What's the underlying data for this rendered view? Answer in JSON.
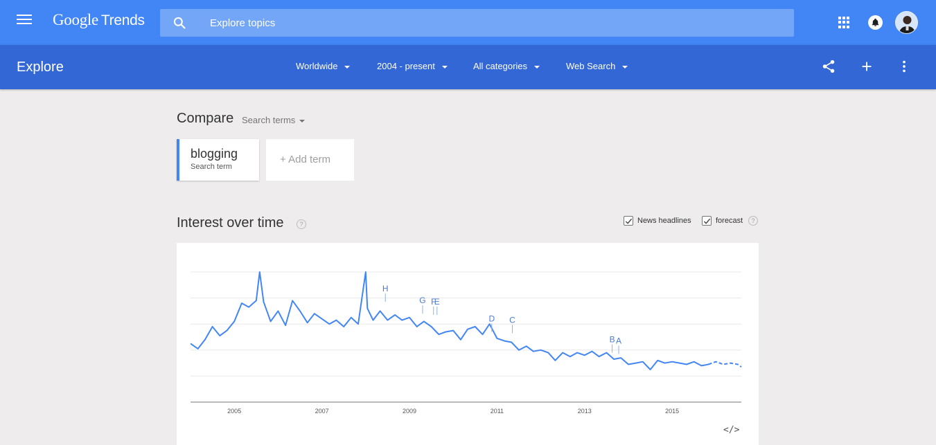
{
  "app": {
    "logo_google": "Google",
    "logo_trends": "Trends"
  },
  "search": {
    "placeholder": "Explore topics"
  },
  "header": {
    "title": "Explore"
  },
  "filters": {
    "region": "Worldwide",
    "time": "2004 - present",
    "category": "All categories",
    "property": "Web Search"
  },
  "compare": {
    "label": "Compare",
    "mode": "Search terms",
    "term": {
      "name": "blogging",
      "type": "Search term"
    },
    "add_label": "+ Add term"
  },
  "interest": {
    "title": "Interest over time",
    "help": "?",
    "news_headlines": "News headlines",
    "forecast": "forecast",
    "embed": "</>"
  },
  "chart_data": {
    "type": "line",
    "title": "",
    "xlabel": "",
    "ylabel": "",
    "xlim": [
      2004.0,
      2016.58
    ],
    "ylim": [
      0,
      100
    ],
    "x_ticks": [
      2005,
      2007,
      2009,
      2011,
      2013,
      2015
    ],
    "tick_labels": [
      "2005",
      "2007",
      "2009",
      "2011",
      "2013",
      "2015"
    ],
    "grid": true,
    "line_color": "#4285f4",
    "series": [
      {
        "x": [
          2004.0,
          2004.17,
          2004.33,
          2004.5,
          2004.67,
          2004.83,
          2005.0,
          2005.17,
          2005.33,
          2005.5,
          2005.58,
          2005.67,
          2005.83,
          2006.0,
          2006.17,
          2006.33,
          2006.5,
          2006.67,
          2006.83,
          2007.0,
          2007.17,
          2007.33,
          2007.5,
          2007.67,
          2007.83,
          2008.0,
          2008.04,
          2008.17,
          2008.33,
          2008.5,
          2008.67,
          2008.83,
          2009.0,
          2009.17,
          2009.33,
          2009.5,
          2009.67,
          2009.83,
          2010.0,
          2010.17,
          2010.33,
          2010.5,
          2010.67,
          2010.83,
          2011.0,
          2011.17,
          2011.33,
          2011.5,
          2011.67,
          2011.83,
          2012.0,
          2012.17,
          2012.33,
          2012.5,
          2012.67,
          2012.83,
          2013.0,
          2013.17,
          2013.33,
          2013.5,
          2013.67,
          2013.83,
          2014.0,
          2014.17,
          2014.33,
          2014.5,
          2014.67,
          2014.83,
          2015.0,
          2015.17,
          2015.33,
          2015.5,
          2015.67,
          2015.83
        ],
        "y": [
          45,
          41,
          48,
          58,
          51,
          55,
          62,
          76,
          73,
          78,
          100,
          77,
          62,
          70,
          59,
          78,
          70,
          61,
          68,
          64,
          60,
          63,
          58,
          65,
          60,
          100,
          72,
          63,
          70,
          63,
          67,
          63,
          65,
          58,
          62,
          58,
          52,
          54,
          55,
          48,
          56,
          58,
          52,
          60,
          49,
          47,
          46,
          40,
          43,
          39,
          40,
          38,
          32,
          38,
          35,
          38,
          36,
          39,
          35,
          38,
          33,
          34,
          29,
          30,
          31,
          25,
          32,
          30,
          31,
          30,
          29,
          31,
          28,
          29
        ]
      },
      {
        "name": "forecast",
        "x": [
          2015.83,
          2016.0,
          2016.17,
          2016.33,
          2016.5,
          2016.58
        ],
        "y": [
          29,
          31,
          29,
          30,
          29,
          27
        ]
      }
    ],
    "annotations": [
      {
        "label": "H",
        "x": 2008.45,
        "y": 77
      },
      {
        "label": "G",
        "x": 2009.3,
        "y": 68
      },
      {
        "label": "F",
        "x": 2009.55,
        "y": 67
      },
      {
        "label": "E",
        "x": 2009.63,
        "y": 67
      },
      {
        "label": "D",
        "x": 2010.88,
        "y": 54
      },
      {
        "label": "C",
        "x": 2011.35,
        "y": 53
      },
      {
        "label": "B",
        "x": 2013.63,
        "y": 38
      },
      {
        "label": "A",
        "x": 2013.78,
        "y": 37
      }
    ]
  }
}
